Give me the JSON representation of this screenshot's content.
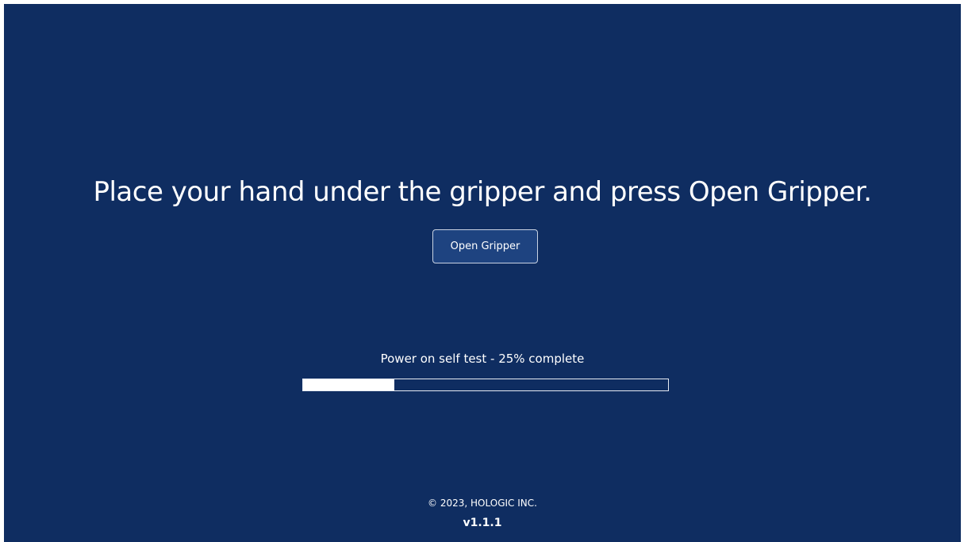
{
  "main": {
    "instruction": "Place your hand under the gripper and press Open Gripper.",
    "open_button_label": "Open Gripper"
  },
  "progress": {
    "label": "Power on self test - 25% complete",
    "percent": 25
  },
  "footer": {
    "copyright": "© 2023, HOLOGIC INC.",
    "version": "v1.1.1"
  },
  "colors": {
    "background": "#0f2d61",
    "button_background": "#1e4380",
    "progress_fill": "#ffffff",
    "text": "#ffffff"
  }
}
